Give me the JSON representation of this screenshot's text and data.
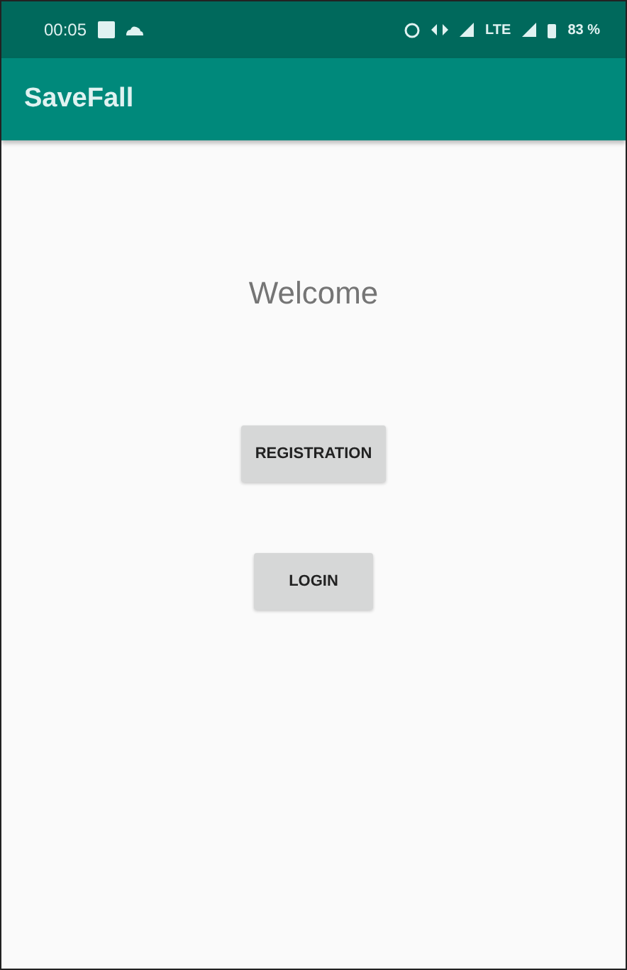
{
  "status_bar": {
    "time": "00:05",
    "network": "LTE",
    "battery": "83 %"
  },
  "app_bar": {
    "title": "SaveFall"
  },
  "heading": "Welcome",
  "buttons": [
    "REGISTRATION",
    "LOGIN"
  ]
}
